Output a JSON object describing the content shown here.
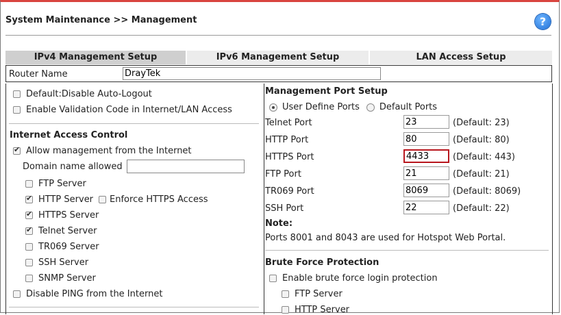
{
  "header": {
    "title": "System Maintenance >> Management",
    "help_icon": "?"
  },
  "tabs": [
    {
      "label": "IPv4 Management Setup",
      "active": true
    },
    {
      "label": "IPv6 Management Setup",
      "active": false
    },
    {
      "label": "LAN Access Setup",
      "active": false
    }
  ],
  "router_name": {
    "label": "Router Name",
    "value": "DrayTek"
  },
  "general": {
    "auto_logout": {
      "label": "Default:Disable Auto-Logout",
      "checked": false
    },
    "validation_code": {
      "label": "Enable Validation Code in Internet/LAN Access",
      "checked": false
    }
  },
  "internet_access": {
    "title": "Internet Access Control",
    "allow_internet": {
      "label": "Allow management from the Internet",
      "checked": true
    },
    "domain_label": "Domain name allowed",
    "domain_value": "",
    "servers": [
      {
        "label": "FTP Server",
        "checked": false
      },
      {
        "label": "HTTP Server",
        "checked": true
      },
      {
        "label": "HTTPS Server",
        "checked": true
      },
      {
        "label": "Telnet Server",
        "checked": true
      },
      {
        "label": "TR069 Server",
        "checked": false
      },
      {
        "label": "SSH Server",
        "checked": false
      },
      {
        "label": "SNMP Server",
        "checked": false
      }
    ],
    "enforce_https": {
      "label": "Enforce HTTPS Access",
      "checked": false
    },
    "disable_ping": {
      "label": "Disable PING from the Internet",
      "checked": false
    }
  },
  "management_ports": {
    "title": "Management Port Setup",
    "user_define": {
      "label": "User Define Ports",
      "selected": true
    },
    "default_ports": {
      "label": "Default Ports",
      "selected": false
    },
    "ports": [
      {
        "label": "Telnet Port",
        "value": "23",
        "default": "(Default: 23)"
      },
      {
        "label": "HTTP Port",
        "value": "80",
        "default": "(Default: 80)"
      },
      {
        "label": "HTTPS Port",
        "value": "4433",
        "default": "(Default: 443)"
      },
      {
        "label": "FTP Port",
        "value": "21",
        "default": "(Default: 21)"
      },
      {
        "label": "TR069 Port",
        "value": "8069",
        "default": "(Default: 8069)"
      },
      {
        "label": "SSH Port",
        "value": "22",
        "default": "(Default: 22)"
      }
    ],
    "note_title": "Note:",
    "note_text": "Ports 8001 and 8043 are used for Hotspot Web Portal."
  },
  "brute_force": {
    "title": "Brute Force Protection",
    "enable": {
      "label": "Enable brute force login protection",
      "checked": false
    },
    "ftp": {
      "label": "FTP Server",
      "checked": false
    },
    "http": {
      "label": "HTTP Server",
      "checked": false
    }
  },
  "colors": {
    "accent": "#d9453f",
    "focus_border": "#b8161d",
    "help_blue": "#1f6fd6"
  }
}
